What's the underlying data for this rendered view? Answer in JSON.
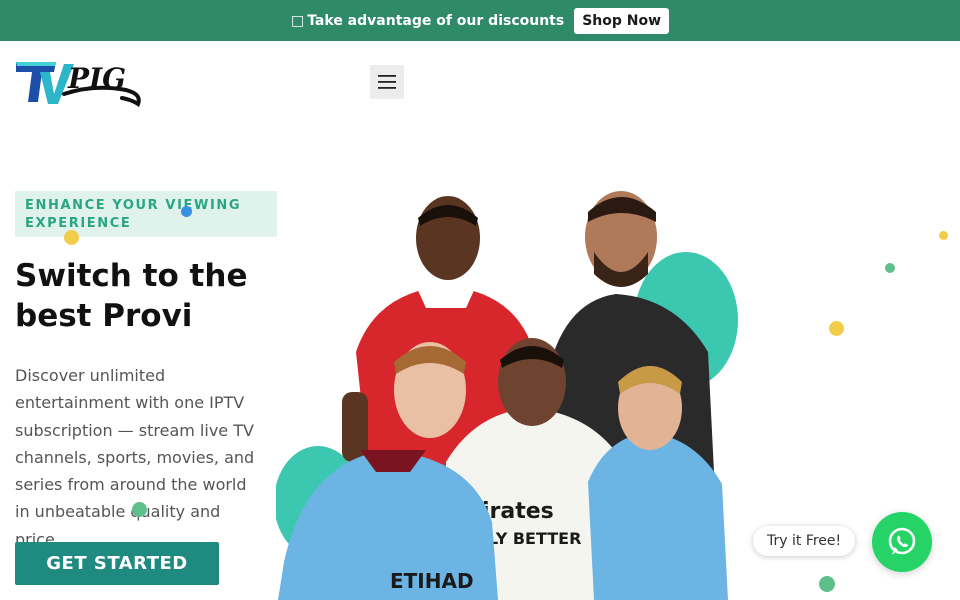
{
  "promo": {
    "icon": "tag-icon",
    "text": "Take advantage of our discounts",
    "button_label": "Shop Now",
    "bg_color": "#2f8a6a"
  },
  "header": {
    "logo_text": "PIG",
    "logo_mark": "TV",
    "menu_icon": "hamburger-icon"
  },
  "hero": {
    "eyebrow": "ENHANCE YOUR VIEWING EXPERIENCE",
    "headline": "Switch to the best Provi",
    "description": "Discover unlimited entertainment with one IPTV subscription — stream live TV channels, sports, movies, and series from around the world in unbeatable quality and price.",
    "cta_label": "GET STARTED",
    "accent_color": "#1f8a80",
    "image_alt": "football-players-image"
  },
  "chat": {
    "label": "Try it Free!",
    "icon": "whatsapp-icon",
    "color": "#25d366"
  }
}
